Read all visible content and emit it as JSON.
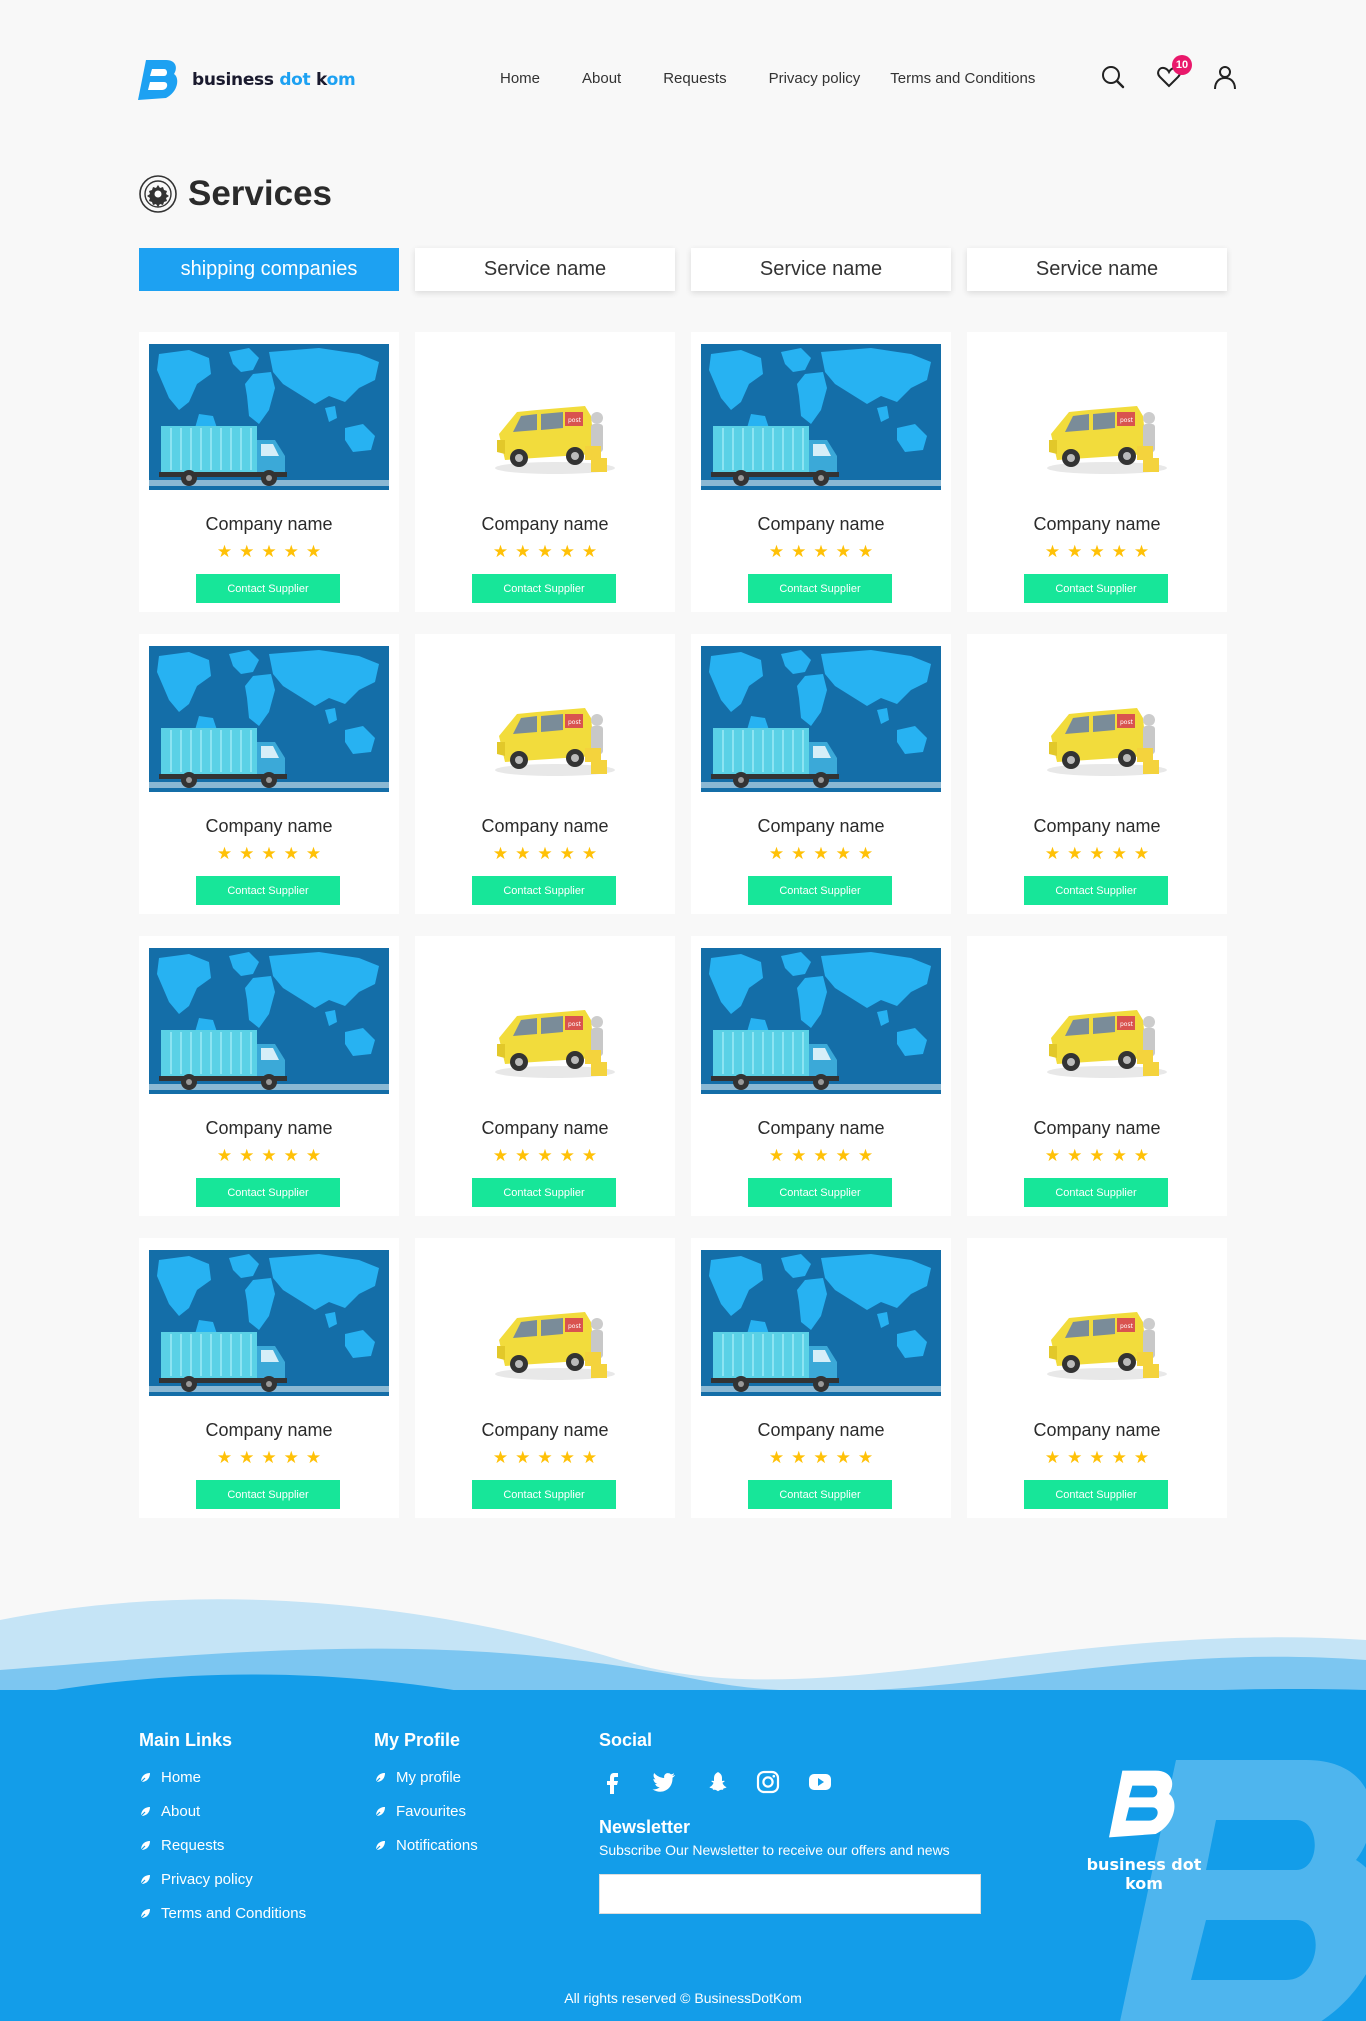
{
  "brand": {
    "name_part1": "business ",
    "name_part2": "dot",
    "name_part3": " k",
    "name_part4": "om",
    "accent": "#1da1f2"
  },
  "nav": {
    "home": "Home",
    "about": "About",
    "requests": "Requests",
    "privacy": "Privacy policy",
    "terms": "Terms and Conditions"
  },
  "header": {
    "favourites_count": "10"
  },
  "page": {
    "title": "Services"
  },
  "tabs": [
    "shipping companies",
    "Service name",
    "Service name",
    "Service name"
  ],
  "cards": {
    "name": "Company name",
    "button": "Contact Supplier",
    "rating": 5,
    "image_pattern": [
      "map-truck",
      "yellow-van",
      "map-truck",
      "yellow-van"
    ]
  },
  "footer": {
    "main_links_title": "Main Links",
    "main_links": [
      "Home",
      "About",
      "Requests",
      "Privacy policy",
      "Terms and Conditions"
    ],
    "profile_title": "My Profile",
    "profile_links": [
      "My profile",
      "Favourites",
      "Notifications"
    ],
    "social_title": "Social",
    "social_icons": [
      "facebook-icon",
      "twitter-icon",
      "snapchat-icon",
      "instagram-icon",
      "youtube-icon"
    ],
    "newsletter_title": "Newsletter",
    "newsletter_text": "Subscribe Our Newsletter to receive our offers and news",
    "newsletter_placeholder": "",
    "logo_text": "business dot kom",
    "copyright": "All rights reserved © BusinessDotKom"
  },
  "colors": {
    "primary": "#1da1f2",
    "footer_bg": "#139de9",
    "button_green": "#17e699",
    "star": "#ffc107",
    "badge": "#e9186b"
  }
}
